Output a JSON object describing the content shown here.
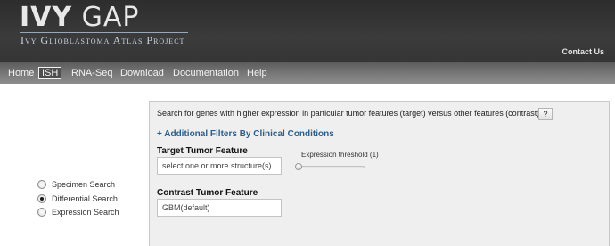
{
  "header": {
    "logo_title_bold": "IVY",
    "logo_title_rest": "GAP",
    "logo_subtitle": "Ivy Glioblastoma Atlas Project",
    "contact_label": "Contact Us"
  },
  "nav": {
    "items": [
      "Home",
      "ISH",
      "RNA-Seq",
      "Download",
      "Documentation",
      "Help"
    ],
    "active": "ISH"
  },
  "search_types": {
    "options": [
      "Specimen Search",
      "Differential Search",
      "Expression Search"
    ],
    "selected": "Differential Search"
  },
  "panel": {
    "description": "Search for genes with higher expression in particular tumor features (target) versus other features (contrast)",
    "help_label": "?",
    "filters_link": "+ Additional Filters By Clinical Conditions",
    "target_label": "Target Tumor Feature",
    "target_placeholder": "select one or more structure(s)",
    "threshold_label": "Expression threshold (1)",
    "threshold_value": 1,
    "contrast_label": "Contrast Tumor Feature",
    "contrast_value": "GBM(default)"
  }
}
